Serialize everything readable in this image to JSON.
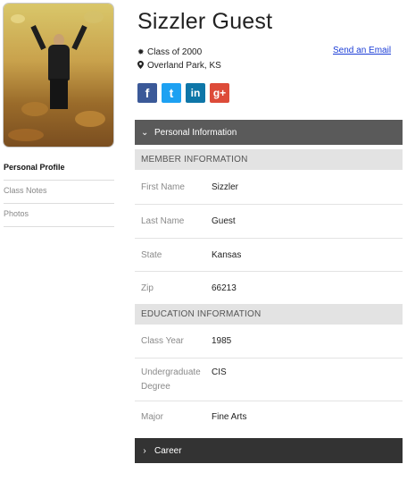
{
  "profile": {
    "name": "Sizzler Guest",
    "class_of": "Class of 2000",
    "location": "Overland Park, KS",
    "email_link": "Send an Email"
  },
  "icons": {
    "class": "gear-icon",
    "location": "map-marker-icon",
    "collapse": "chevron-down-icon",
    "expand": "chevron-right-icon"
  },
  "social": [
    {
      "name": "facebook",
      "glyph": "f",
      "color": "#3b5998"
    },
    {
      "name": "twitter",
      "glyph": "t",
      "color": "#1da1f2"
    },
    {
      "name": "linkedin",
      "glyph": "in",
      "color": "#0e76a8"
    },
    {
      "name": "google-plus",
      "glyph": "g+",
      "color": "#dd4b39"
    }
  ],
  "sidebar": {
    "items": [
      {
        "label": "Personal Profile",
        "active": true
      },
      {
        "label": "Class Notes",
        "active": false
      },
      {
        "label": "Photos",
        "active": false
      }
    ]
  },
  "panels": {
    "personal_info": "Personal Information",
    "career": "Career"
  },
  "member_info": {
    "header": "MEMBER INFORMATION",
    "fields": [
      {
        "label": "First Name",
        "value": "Sizzler"
      },
      {
        "label": "Last Name",
        "value": "Guest"
      },
      {
        "label": "State",
        "value": "Kansas"
      },
      {
        "label": "Zip",
        "value": "66213"
      }
    ]
  },
  "education_info": {
    "header": "EDUCATION INFORMATION",
    "fields": [
      {
        "label": "Class Year",
        "value": "1985"
      },
      {
        "label": "Undergraduate Degree",
        "value": "CIS"
      },
      {
        "label": "Major",
        "value": "Fine Arts"
      }
    ]
  },
  "colors": {
    "panel_header": "#5a5a5a",
    "career_header": "#333333",
    "section_header": "#e3e3e3",
    "link": "#1a3cd6"
  }
}
